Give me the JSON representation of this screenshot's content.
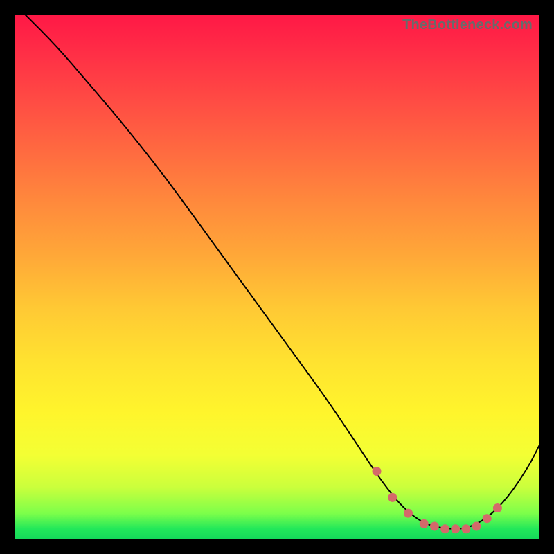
{
  "watermark": "TheBottleneck.com",
  "palette": {
    "curve_stroke": "#000000",
    "marker_fill": "#d46a6a",
    "marker_stroke": "#d46a6a"
  },
  "chart_data": {
    "type": "line",
    "title": "",
    "xlabel": "",
    "ylabel": "",
    "xlim": [
      0,
      100
    ],
    "ylim": [
      0,
      100
    ],
    "grid": false,
    "legend": false,
    "note": "Axes unlabeled in source image. x/y are 0–100 positional estimates (x left→right, y low→high).",
    "x": [
      2,
      8,
      14,
      20,
      28,
      36,
      44,
      52,
      60,
      66,
      70,
      74,
      78,
      82,
      86,
      90,
      94,
      98,
      100
    ],
    "values": [
      100,
      94,
      87,
      80,
      70,
      59,
      48,
      37,
      26,
      17,
      11,
      6,
      3,
      2,
      2,
      4,
      8,
      14,
      18
    ],
    "markers_x": [
      69,
      72,
      75,
      78,
      80,
      82,
      84,
      86,
      88,
      90,
      92
    ],
    "markers_y": [
      13,
      8,
      5,
      3,
      2.5,
      2,
      2,
      2,
      2.5,
      4,
      6
    ]
  }
}
